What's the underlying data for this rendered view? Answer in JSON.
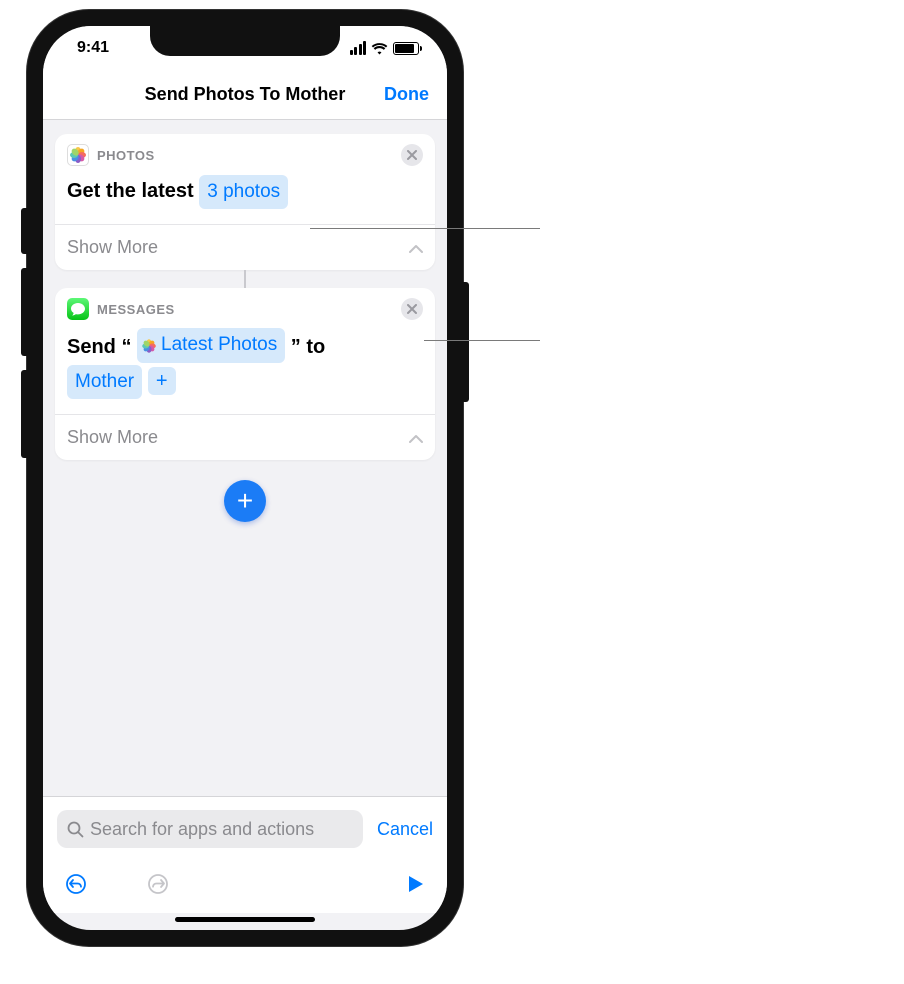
{
  "status": {
    "time": "9:41"
  },
  "nav": {
    "title": "Send Photos To Mother",
    "done": "Done"
  },
  "action1": {
    "app": "PHOTOS",
    "text_prefix": "Get the latest",
    "token": "3 photos",
    "show_more": "Show More"
  },
  "action2": {
    "app": "MESSAGES",
    "text_send": "Send",
    "quote_open": "“",
    "variable": "Latest Photos",
    "quote_close": "”",
    "text_to": "to",
    "recipient": "Mother",
    "show_more": "Show More"
  },
  "search": {
    "placeholder": "Search for apps and actions",
    "cancel": "Cancel"
  }
}
